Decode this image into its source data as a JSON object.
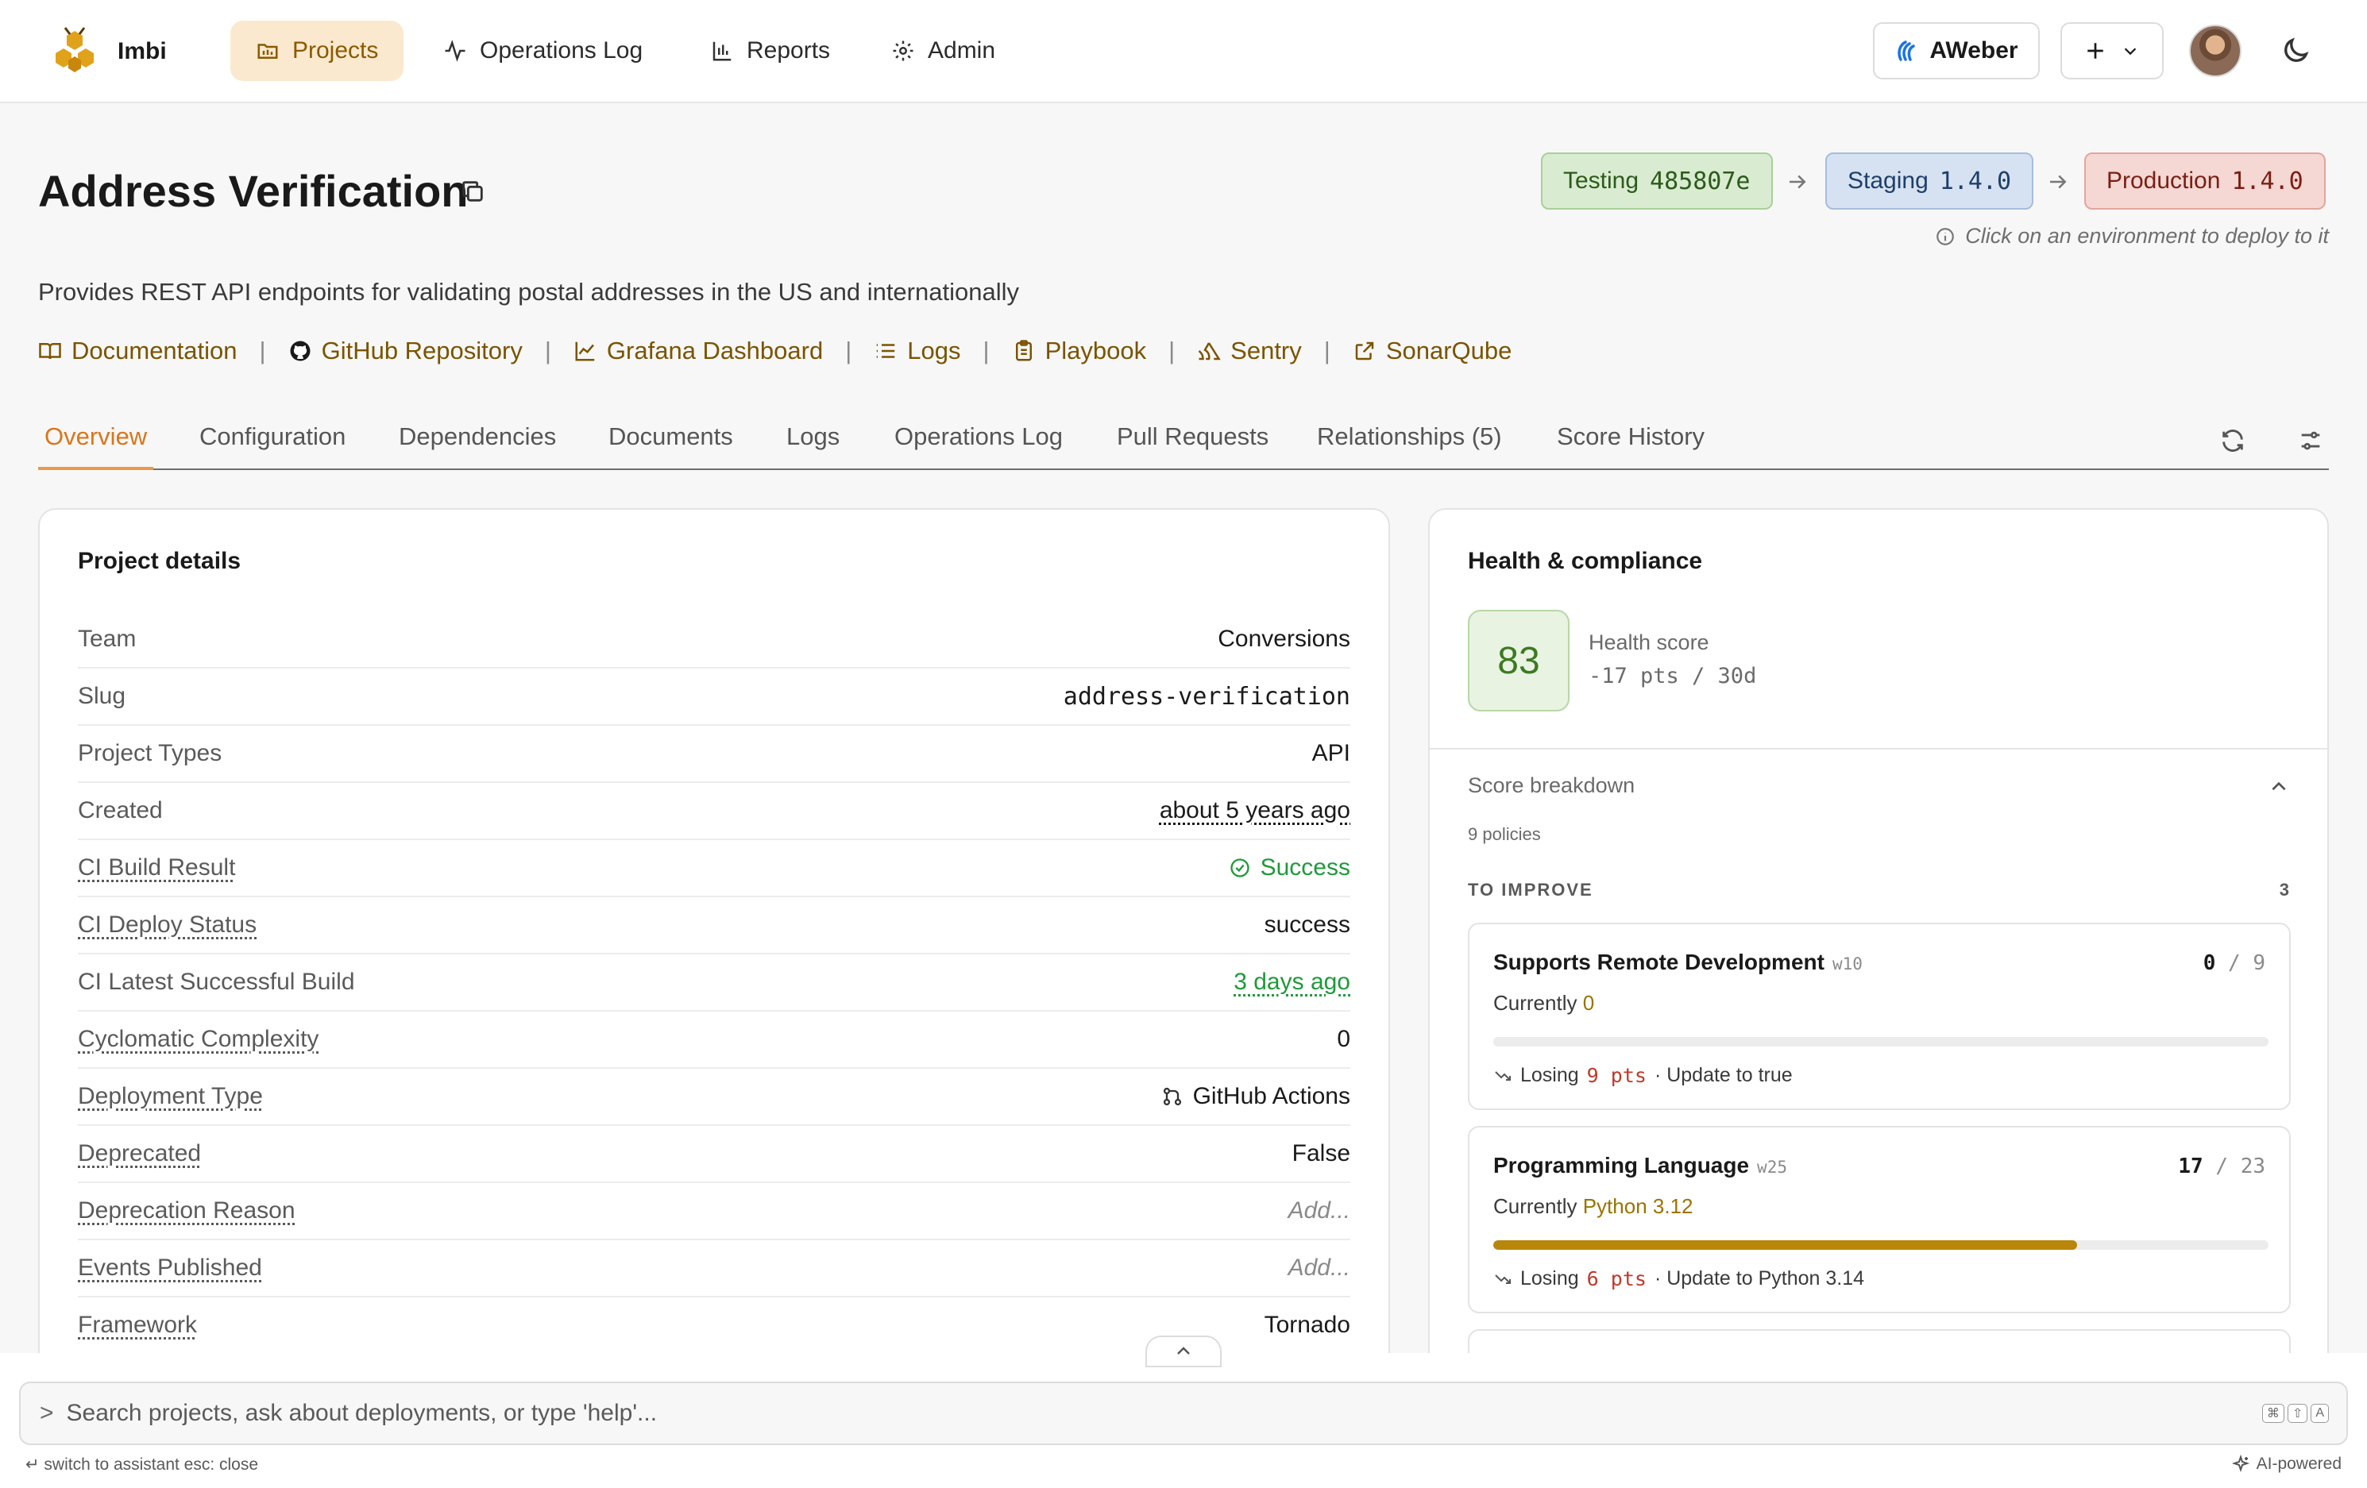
{
  "nav": {
    "brand": "Imbi",
    "items": [
      {
        "label": "Projects",
        "icon": "folder-icon",
        "active": true
      },
      {
        "label": "Operations Log",
        "icon": "activity-icon",
        "active": false
      },
      {
        "label": "Reports",
        "icon": "bar-chart-icon",
        "active": false
      },
      {
        "label": "Admin",
        "icon": "gear-icon",
        "active": false
      }
    ],
    "org": "AWeber",
    "add_icon": "plus-icon",
    "theme_icon": "moon-icon"
  },
  "project": {
    "title": "Address Verification",
    "description": "Provides REST API endpoints for validating postal addresses in the US and internationally",
    "environments": [
      {
        "name": "Testing",
        "version": "485807e",
        "color": "#d9ecd1"
      },
      {
        "name": "Staging",
        "version": "1.4.0",
        "color": "#d6e2f1"
      },
      {
        "name": "Production",
        "version": "1.4.0",
        "color": "#f5d7d3"
      }
    ],
    "env_hint": "Click on an environment to deploy to it",
    "links": [
      {
        "label": "Documentation",
        "icon": "book-icon"
      },
      {
        "label": "GitHub Repository",
        "icon": "github-icon"
      },
      {
        "label": "Grafana Dashboard",
        "icon": "line-chart-icon"
      },
      {
        "label": "Logs",
        "icon": "list-icon"
      },
      {
        "label": "Playbook",
        "icon": "clipboard-icon"
      },
      {
        "label": "Sentry",
        "icon": "sentry-icon"
      },
      {
        "label": "SonarQube",
        "icon": "external-link-icon"
      }
    ],
    "link_separator": "|"
  },
  "tabs": [
    {
      "label": "Overview",
      "active": true
    },
    {
      "label": "Configuration"
    },
    {
      "label": "Dependencies"
    },
    {
      "label": "Documents"
    },
    {
      "label": "Logs"
    },
    {
      "label": "Operations Log"
    },
    {
      "label": "Pull Requests"
    },
    {
      "label": "Relationships (5)"
    },
    {
      "label": "Score History"
    }
  ],
  "details": {
    "title": "Project details",
    "rows": [
      {
        "label": "Team",
        "value": "Conversions"
      },
      {
        "label": "Slug",
        "value": "address-verification"
      },
      {
        "label": "Project Types",
        "value": "API"
      },
      {
        "label": "Created",
        "value": "about 5 years ago"
      },
      {
        "label": "CI Build Result",
        "value": "Success"
      },
      {
        "label": "CI Deploy Status",
        "value": "success"
      },
      {
        "label": "CI Latest Successful Build",
        "value": "3 days ago"
      },
      {
        "label": "Cyclomatic Complexity",
        "value": "0"
      },
      {
        "label": "Deployment Type",
        "value": "GitHub Actions"
      },
      {
        "label": "Deprecated",
        "value": "False"
      },
      {
        "label": "Deprecation Reason",
        "value": "Add..."
      },
      {
        "label": "Events Published",
        "value": "Add..."
      },
      {
        "label": "Framework",
        "value": "Tornado"
      }
    ]
  },
  "health": {
    "title": "Health & compliance",
    "score": "83",
    "score_label": "Health score",
    "score_delta": "-17 pts / 30d",
    "breakdown_title": "Score breakdown",
    "policies_count": "9 policies",
    "improve_title": "TO IMPROVE",
    "improve_count": "3",
    "policies": [
      {
        "name": "Supports Remote Development",
        "weight": "w10",
        "score": "0",
        "max": "9",
        "current_prefix": "Currently",
        "current": "0",
        "progress": 0.0,
        "losing_prefix": "Losing",
        "losing": "9",
        "pts": "pts",
        "hint": "· Update to true"
      },
      {
        "name": "Programming Language",
        "weight": "w25",
        "score": "17",
        "max": "23",
        "current_prefix": "Currently",
        "current": "Python 3.12",
        "progress": 0.753,
        "losing_prefix": "Losing",
        "losing": "6",
        "pts": "pts",
        "hint": "· Update to Python 3.14"
      }
    ]
  },
  "command_bar": {
    "prompt": ">",
    "placeholder": "Search projects, ask about deployments, or type 'help'...",
    "shortcut": [
      "⌘",
      "⇧",
      "A"
    ],
    "hint_left": "↵ switch to assistant  esc: close",
    "hint_right": "AI-powered"
  }
}
